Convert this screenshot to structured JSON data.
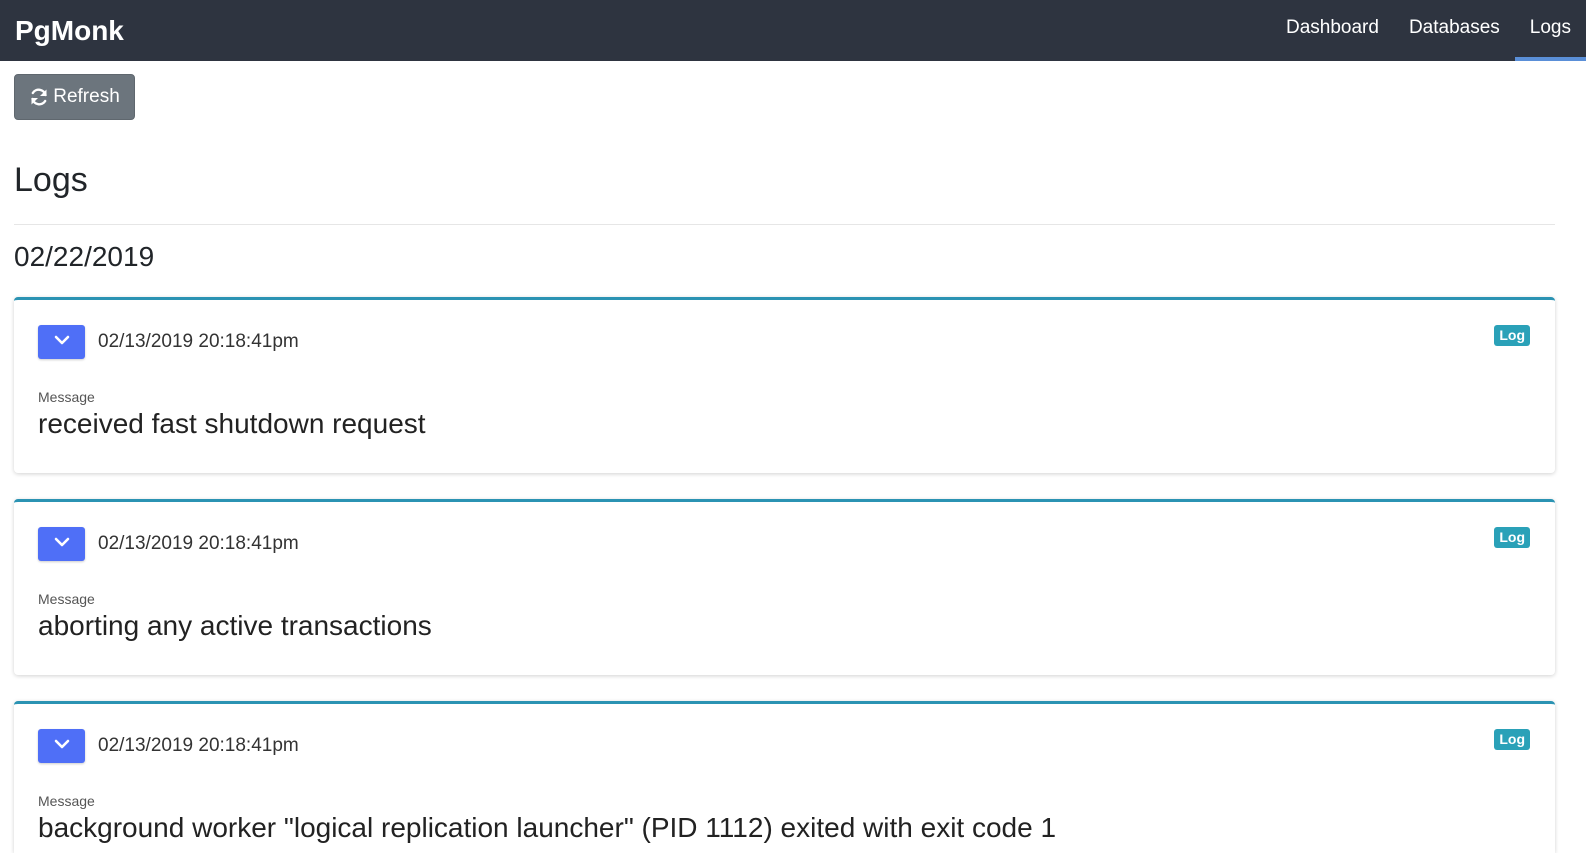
{
  "navbar": {
    "brand": "PgMonk",
    "links": [
      {
        "label": "Dashboard",
        "active": false
      },
      {
        "label": "Databases",
        "active": false
      },
      {
        "label": "Logs",
        "active": true
      }
    ]
  },
  "toolbar": {
    "refresh_label": "Refresh",
    "refresh_icon": "refresh-icon"
  },
  "page": {
    "title": "Logs",
    "date_heading": "02/22/2019"
  },
  "logs": [
    {
      "timestamp": "02/13/2019 20:18:41pm",
      "badge": "Log",
      "message_label": "Message",
      "message": "received fast shutdown request"
    },
    {
      "timestamp": "02/13/2019 20:18:41pm",
      "badge": "Log",
      "message_label": "Message",
      "message": "aborting any active transactions"
    },
    {
      "timestamp": "02/13/2019 20:18:41pm",
      "badge": "Log",
      "message_label": "Message",
      "message": "background worker \"logical replication launcher\" (PID 1112) exited with exit code 1"
    }
  ],
  "colors": {
    "navbar_bg": "#2e3440",
    "nav_active_underline": "#5a8fd8",
    "refresh_button": "#6c757d",
    "card_border": "#2b93b3",
    "toggle_button": "#4f6ff7",
    "badge": "#2aa1b8"
  }
}
